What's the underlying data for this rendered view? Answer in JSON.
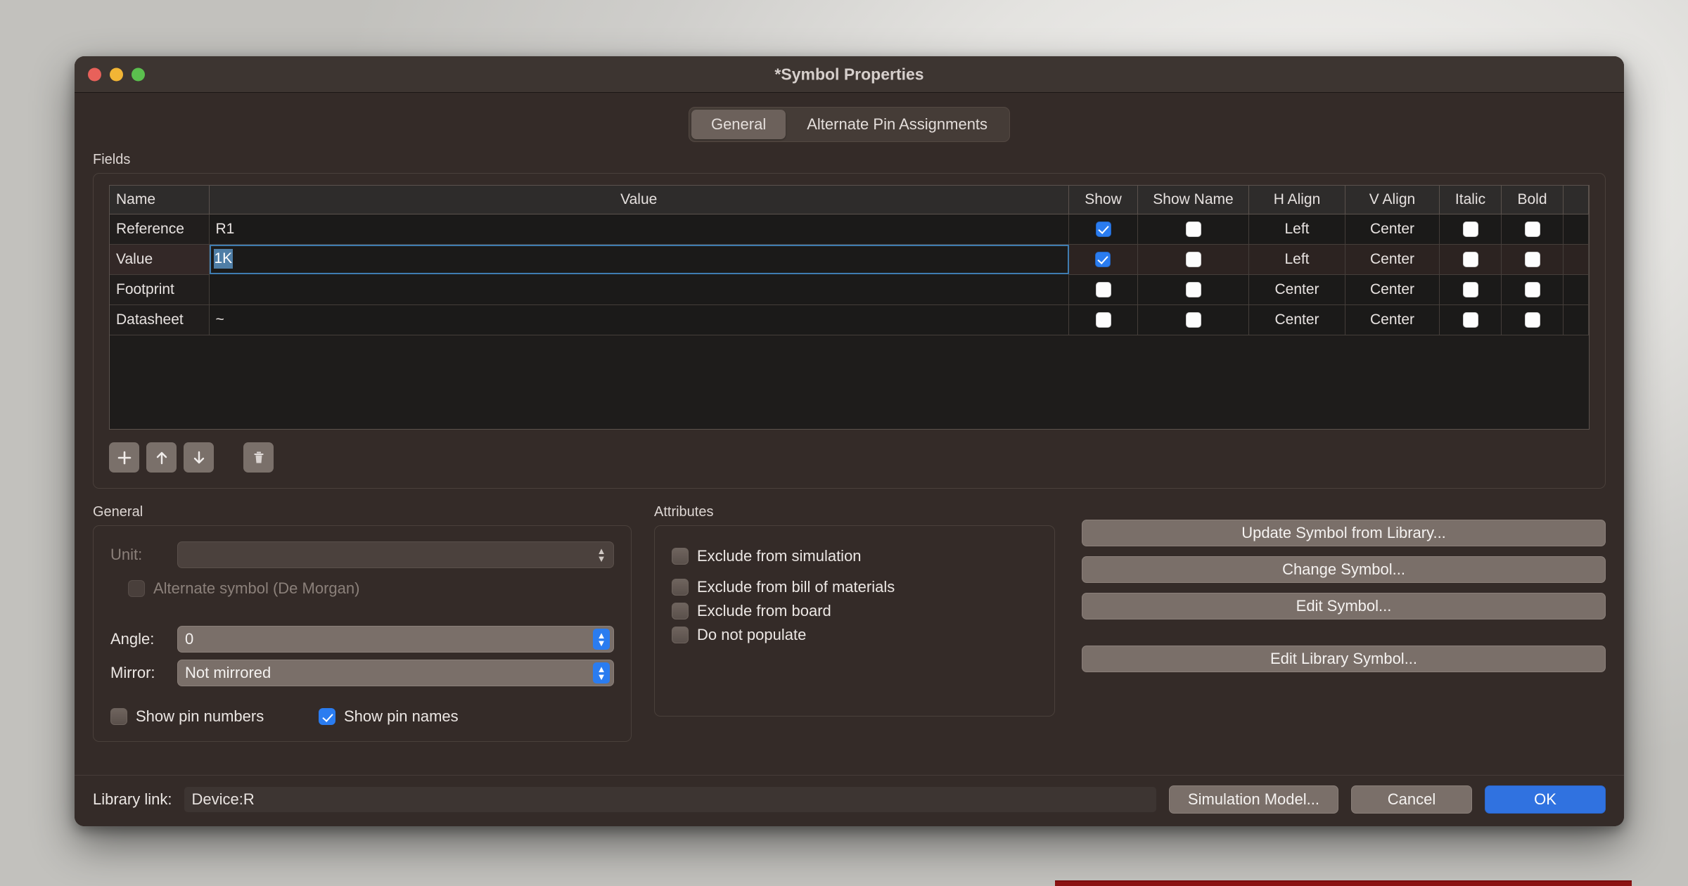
{
  "window": {
    "title": "*Symbol Properties",
    "traffic_lights": [
      "close",
      "minimize",
      "zoom"
    ]
  },
  "tabs": [
    {
      "label": "General",
      "active": true
    },
    {
      "label": "Alternate Pin Assignments",
      "active": false
    }
  ],
  "fields": {
    "group_label": "Fields",
    "columns": [
      "Name",
      "Value",
      "Show",
      "Show Name",
      "H Align",
      "V Align",
      "Italic",
      "Bold"
    ],
    "rows": [
      {
        "name": "Reference",
        "value": "R1",
        "show": true,
        "show_name": false,
        "h_align": "Left",
        "v_align": "Center",
        "italic": false,
        "bold": false,
        "selected": false,
        "editing": false
      },
      {
        "name": "Value",
        "value": "1K",
        "show": true,
        "show_name": false,
        "h_align": "Left",
        "v_align": "Center",
        "italic": false,
        "bold": false,
        "selected": true,
        "editing": true
      },
      {
        "name": "Footprint",
        "value": "",
        "show": false,
        "show_name": false,
        "h_align": "Center",
        "v_align": "Center",
        "italic": false,
        "bold": false,
        "selected": false,
        "editing": false
      },
      {
        "name": "Datasheet",
        "value": "~",
        "show": false,
        "show_name": false,
        "h_align": "Center",
        "v_align": "Center",
        "italic": false,
        "bold": false,
        "selected": false,
        "editing": false
      }
    ],
    "toolbar": [
      {
        "icon": "plus-icon",
        "tooltip": "Add field"
      },
      {
        "icon": "arrow-up-icon",
        "tooltip": "Move up"
      },
      {
        "icon": "arrow-down-icon",
        "tooltip": "Move down"
      },
      {
        "icon": "trash-icon",
        "tooltip": "Delete field"
      }
    ]
  },
  "general": {
    "group_label": "General",
    "unit_label": "Unit:",
    "unit_value": "",
    "unit_disabled": true,
    "alternate_symbol_label": "Alternate symbol (De Morgan)",
    "alternate_symbol_checked": false,
    "alternate_symbol_disabled": true,
    "angle_label": "Angle:",
    "angle_value": "0",
    "mirror_label": "Mirror:",
    "mirror_value": "Not mirrored",
    "show_pin_numbers_label": "Show pin numbers",
    "show_pin_numbers_checked": false,
    "show_pin_names_label": "Show pin names",
    "show_pin_names_checked": true
  },
  "attributes": {
    "group_label": "Attributes",
    "items": [
      {
        "label": "Exclude from simulation",
        "checked": false
      },
      {
        "label": "Exclude from bill of materials",
        "checked": false
      },
      {
        "label": "Exclude from board",
        "checked": false
      },
      {
        "label": "Do not populate",
        "checked": false
      }
    ]
  },
  "actions": {
    "update_symbol": "Update Symbol from Library...",
    "change_symbol": "Change Symbol...",
    "edit_symbol": "Edit Symbol...",
    "edit_library_symbol": "Edit Library Symbol..."
  },
  "footer": {
    "library_link_label": "Library link:",
    "library_link_value": "Device:R",
    "simulation_model": "Simulation Model...",
    "cancel": "Cancel",
    "ok": "OK"
  },
  "colors": {
    "accent_blue": "#2a7cf0",
    "ok_button": "#3072e0",
    "dialog_bg": "#342b28",
    "titlebar_bg": "#3d3531",
    "grid_bg": "#1b1a19",
    "selection_blue": "#4f7ea6",
    "focus_border": "#3f7cb0"
  }
}
